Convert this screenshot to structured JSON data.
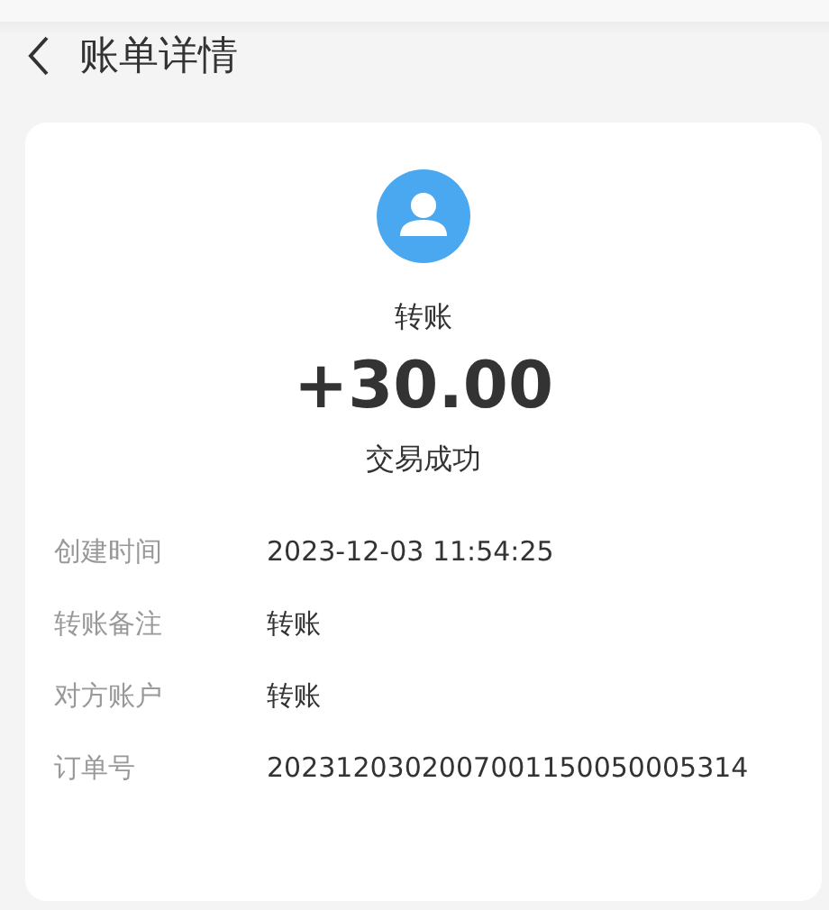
{
  "header": {
    "title": "账单详情"
  },
  "summary": {
    "type": "转账",
    "amount": "+30.00",
    "status": "交易成功"
  },
  "details": [
    {
      "label": "创建时间",
      "value": "2023-12-03 11:54:25"
    },
    {
      "label": "转账备注",
      "value": "转账"
    },
    {
      "label": "对方账户",
      "value": "转账"
    },
    {
      "label": "订单号",
      "value": "2023120302007001150050005314"
    }
  ]
}
